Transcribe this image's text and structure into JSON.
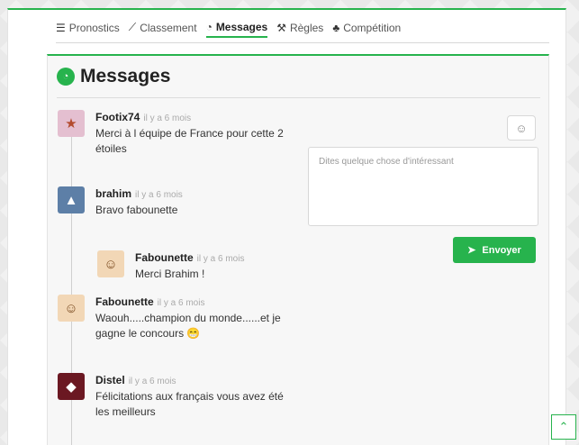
{
  "nav": {
    "items": [
      {
        "icon": "sliders-icon",
        "glyph": "☰",
        "label": "Pronostics",
        "active": false
      },
      {
        "icon": "chart-line-icon",
        "glyph": "⟋",
        "label": "Classement",
        "active": false
      },
      {
        "icon": "comments-icon",
        "glyph": "◔",
        "label": "Messages",
        "active": true
      },
      {
        "icon": "gavel-icon",
        "glyph": "⚒",
        "label": "Règles",
        "active": false
      },
      {
        "icon": "sitemap-icon",
        "glyph": "♣",
        "label": "Compétition",
        "active": false
      }
    ]
  },
  "panel": {
    "title": "Messages",
    "icon": "comments-icon"
  },
  "messages": [
    {
      "author": "Footix74",
      "time": "il y a 6 mois",
      "text": "Merci à l équipe de France pour cette 2 étoiles",
      "avatar": "star-face-avatar",
      "avatar_color": "#e4bfd0",
      "glyph": "★"
    },
    {
      "author": "brahim",
      "time": "il y a 6 mois",
      "text": "Bravo fabounette",
      "avatar": "badge-avatar",
      "avatar_color": "#5d7fa7",
      "glyph": "▲"
    },
    {
      "author": "Fabounette",
      "time": "il y a 6 mois",
      "text": "Merci Brahim !",
      "avatar": "cartoon-girl-avatar",
      "avatar_color": "#f2d7b6",
      "glyph": "☺"
    },
    {
      "author": "Fabounette",
      "time": "il y a 6 mois",
      "text": "Waouh.....champion du monde......et je gagne le concours 😁",
      "avatar": "cartoon-girl-avatar",
      "avatar_color": "#f2d7b6",
      "glyph": "☺"
    },
    {
      "author": "Distel",
      "time": "il y a 6 mois",
      "text": "Félicitations aux français vous avez été les meilleurs",
      "avatar": "logo-avatar",
      "avatar_color": "#6b1822",
      "glyph": "◆"
    }
  ],
  "composer": {
    "emoji_icon": "smile-icon",
    "placeholder": "Dites quelque chose d'intéressant",
    "send_label": "Envoyer",
    "send_icon": "paper-plane-icon"
  },
  "scroll_top_icon": "chevron-up-icon",
  "colors": {
    "accent": "#27b34d"
  }
}
